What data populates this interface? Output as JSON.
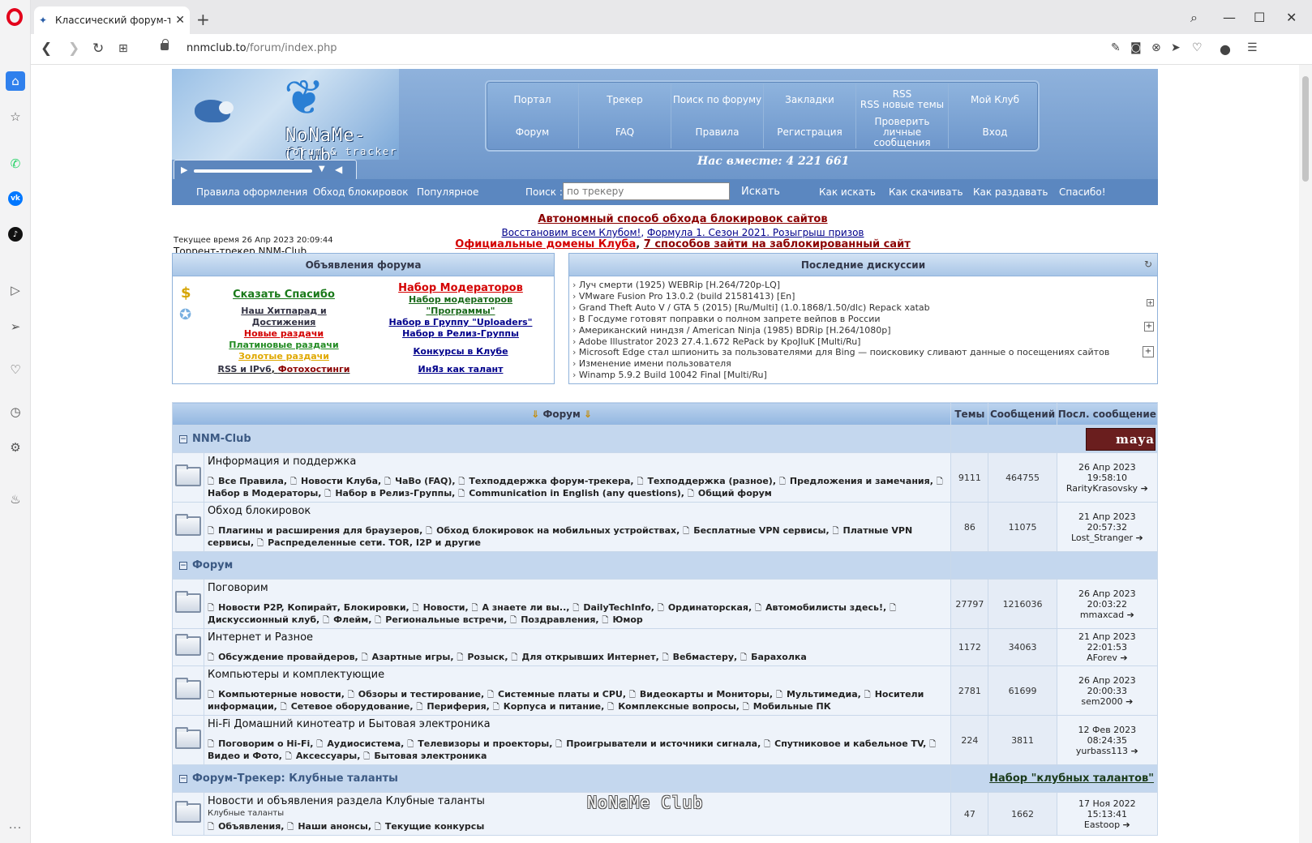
{
  "browser": {
    "tab_title": "Классический форум-трекер",
    "url_host": "nnmclub.to",
    "url_path": "/forum/index.php"
  },
  "header": {
    "logo_title": "NoNaMe-Club",
    "logo_sub": "forum & tracker",
    "together": "Нас вместе: 4 221 661",
    "nav_top": [
      "Портал",
      "Трекер",
      "Поиск по форуму",
      "Закладки",
      "RSS\nRSS новые темы",
      "Мой Клуб"
    ],
    "nav_bottom": [
      "Форум",
      "FAQ",
      "Правила",
      "Регистрация",
      "Проверить личные сообщения",
      "Вход"
    ]
  },
  "subnav": {
    "links_left": [
      "Правила оформления",
      "Обход блокировок",
      "Популярное"
    ],
    "search_label": "Поиск :",
    "search_placeholder": "по трекеру",
    "search_button": "Искать",
    "links_right": [
      "Как искать",
      "Как скачивать",
      "Как раздавать",
      "Спасибо!"
    ]
  },
  "notices": {
    "time": "Текущее время 26 Апр 2023 20:09:44",
    "tracker_title": "Торрент-трекер NNM-Club",
    "line1": "Автономный способ обхода блокировок сайтов",
    "line2a": "Восстановим всем Клубом!",
    "line2b": "Формула 1. Сезон 2021. Розыгрыш призов",
    "line3a": "Официальные домены Клуба",
    "line3b": "7 способов зайти на заблокированный сайт"
  },
  "announcements": {
    "title": "Объявления форума",
    "left": [
      {
        "text": "Сказать Спасибо",
        "color": "#1a7a1a",
        "size": 13
      },
      {
        "text": "Наш Хитпарад и Достижения",
        "color": "#333344",
        "size": 11
      },
      {
        "text": "Новые раздачи",
        "color": "#d40000",
        "size": 11
      },
      {
        "text": "Платиновые раздачи",
        "color": "#228b22",
        "size": 11
      },
      {
        "text": "Золотые раздачи",
        "color": "#e0a800",
        "size": 11
      }
    ],
    "left_last_a": "RSS и IPv6",
    "left_last_b": "Фотохостинги",
    "right": [
      {
        "text": "Набор Модераторов",
        "color": "#d40000",
        "size": 13
      },
      {
        "text": "Набор модераторов \"Программы\"",
        "color": "#1a6a1a",
        "size": 11
      },
      {
        "text": "Набор в Группу \"Uploaders\"",
        "color": "#00008b",
        "size": 11
      },
      {
        "text": "Набор в Релиз-Группы",
        "color": "#00008b",
        "size": 11
      }
    ],
    "right_contests": "Конкурсы в Клубе",
    "right_talent": "ИнЯз как талант"
  },
  "discussions": {
    "title": "Последние дискуссии",
    "items": [
      "Луч смерти (1925) WEBRip [H.264/720p-LQ]",
      "VMware Fusion Pro 13.0.2 (build 21581413) [En]",
      "Grand Theft Auto V / GTA 5 (2015) [Ru/Multi] (1.0.1868/1.50/dlc) Repack xatab",
      "В Госдуме готовят поправки о полном запрете вейпов в России",
      "Американский ниндзя / American Ninja (1985) BDRip [H.264/1080p]",
      "Adobe Illustrator 2023 27.4.1.672 RePack by KpoJIuK [Multi/Ru]",
      "Microsoft Edge стал шпионить за пользователями для Bing — поисковику сливают данные о посещениях сайтов",
      "Изменение имени пользователя",
      "Winamp 5.9.2 Build 10042 Final [Multi/Ru]"
    ]
  },
  "table": {
    "head_forum": "Форум",
    "head_topics": "Темы",
    "head_posts": "Сообщений",
    "head_last": "Посл. сообщение",
    "cat1": "NNM-Club",
    "cat1_badge": "maya",
    "cat2": "Форум",
    "cat3": "Форум-Трекер: Клубные таланты",
    "cat3_link": "Набор \"клубных талантов\"",
    "forums": [
      {
        "name": "Информация и поддержка",
        "desc": "",
        "subs": [
          "Все Правила",
          "Новости Клуба",
          "ЧаВо (FAQ)",
          "Техподдержка форум-трекера",
          "Техподдержка (разное)",
          "Предложения и замечания",
          "Набор в Модераторы",
          "Набор в Релиз-Группы",
          "Communication in English (any questions)",
          "Общий форум"
        ],
        "topics": "9111",
        "posts": "464755",
        "last_date": "26 Апр 2023 19:58:10",
        "last_user": "RarityKrasovsky"
      },
      {
        "name": "Обход блокировок",
        "desc": "",
        "subs": [
          "Плагины и расширения для браузеров",
          "Обход блокировок на мобильных устройствах",
          "Бесплатные VPN сервисы",
          "Платные VPN сервисы",
          "Распределенные сети. TOR, I2P и другие"
        ],
        "topics": "86",
        "posts": "11075",
        "last_date": "21 Апр 2023 20:57:32",
        "last_user": "Lost_Stranger"
      },
      {
        "name": "Поговорим",
        "desc": "",
        "subs": [
          "Новости P2P, Копирайт, Блокировки",
          "Новости",
          "А знаете ли вы..",
          "DailyTechInfo",
          "Ординаторская",
          "Автомобилисты здесь!",
          "Дискуссионный клуб",
          "Флейм",
          "Региональные встречи",
          "Поздравления",
          "Юмор"
        ],
        "topics": "27797",
        "posts": "1216036",
        "last_date": "26 Апр 2023 20:03:22",
        "last_user": "mmaxcad"
      },
      {
        "name": "Интернет и Разное",
        "desc": "",
        "subs": [
          "Обсуждение провайдеров",
          "Азартные игры",
          "Розыск",
          "Для открывших Интернет",
          "Вебмастеру",
          "Барахолка"
        ],
        "topics": "1172",
        "posts": "34063",
        "last_date": "21 Апр 2023 22:01:53",
        "last_user": "AForev"
      },
      {
        "name": "Компьютеры и комплектующие",
        "desc": "",
        "subs": [
          "Компьютерные новости",
          "Обзоры и тестирование",
          "Системные платы и CPU",
          "Видеокарты и Мониторы",
          "Мультимедиа",
          "Носители информации",
          "Сетевое оборудование",
          "Периферия",
          "Корпуса и питание",
          "Комплексные вопросы",
          "Мобильные ПК"
        ],
        "topics": "2781",
        "posts": "61699",
        "last_date": "26 Апр 2023 20:00:33",
        "last_user": "sem2000"
      },
      {
        "name": "Hi-Fi Домашний кинотеатр и Бытовая электроника",
        "desc": "",
        "subs": [
          "Поговорим о Hi-Fi",
          "Аудиосистема",
          "Телевизоры и проекторы",
          "Проигрыватели и источники сигнала",
          "Спутниковое и кабельное TV",
          "Видео и Фото",
          "Аксессуары",
          "Бытовая электроника"
        ],
        "topics": "224",
        "posts": "3811",
        "last_date": "12 Фев 2023 08:24:35",
        "last_user": "yurbass113"
      },
      {
        "name": "Новости и объявления раздела Клубные таланты",
        "desc": "Клубные таланты",
        "subs": [
          "Объявления",
          "Наши анонсы",
          "Текущие конкурсы"
        ],
        "topics": "47",
        "posts": "1662",
        "last_date": "17 Ноя 2022 15:13:41",
        "last_user": "Eastoop"
      }
    ]
  },
  "watermark": "NoNaMe Club"
}
